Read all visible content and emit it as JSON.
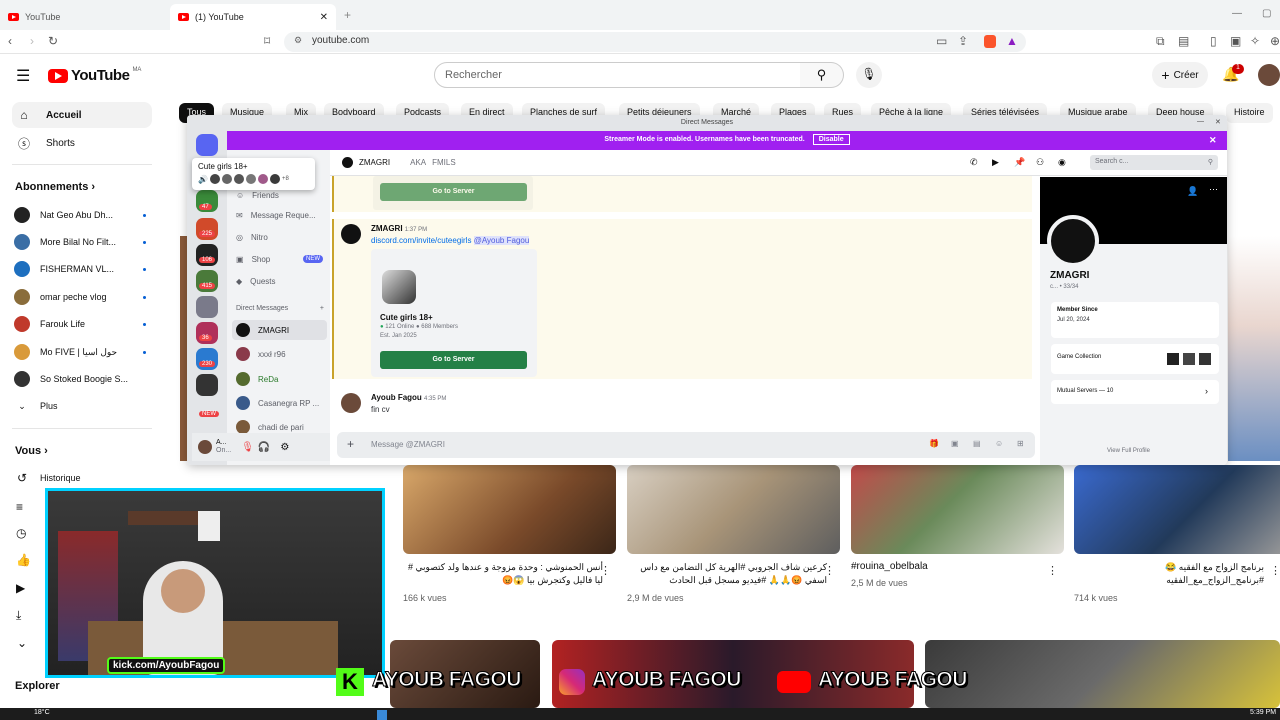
{
  "browser": {
    "tabs": [
      {
        "label": "YouTube"
      },
      {
        "label": "(1) YouTube"
      }
    ],
    "url": "youtube.com"
  },
  "youtube": {
    "logo_text": "YouTube",
    "logo_country": "MA",
    "search_placeholder": "Rechercher",
    "create_label": "Créer",
    "notif_count": "1",
    "sidebar": {
      "items": [
        {
          "label": "Accueil"
        },
        {
          "label": "Shorts"
        }
      ],
      "subscriptions_title": "Abonnements",
      "subscriptions": [
        {
          "label": "Nat Geo Abu Dh...",
          "color": "#222222"
        },
        {
          "label": "More Bilal No Filt...",
          "color": "#3a6ea5"
        },
        {
          "label": "FISHERMAN VL...",
          "color": "#1d6fbf"
        },
        {
          "label": "omar peche vlog",
          "color": "#8a6d3b"
        },
        {
          "label": "Farouk Life",
          "color": "#c0392b"
        },
        {
          "label": "Mo FIVE | حول اسيا",
          "color": "#d99a3a"
        },
        {
          "label": "So Stoked Boogie S...",
          "color": "#333333"
        }
      ],
      "more_label": "Plus",
      "you_title": "Vous",
      "history_label": "Historique",
      "explore_title": "Explorer"
    },
    "chips": [
      "Tous",
      "Musique",
      "Mix",
      "Bodyboard",
      "Podcasts",
      "En direct",
      "Planches de surf",
      "Petits déjeuners",
      "Marché",
      "Plages",
      "Rues",
      "Pêche à la ligne",
      "Séries télévisées",
      "Musique arabe",
      "Deep house",
      "Histoire"
    ],
    "videos": [
      {
        "title": "أنس الحمنوشي : وحدة مزوجة و عندها ولد كتصوبي #\nليا فاليل وكتجرش بيا 😱😡",
        "views": "166 k vues",
        "color": "#b07a3c"
      },
      {
        "title": "كرعين شاف الجروبي #الهرية كل التضامن مع داس\nاسفي 😡🙏🙏 #فيديو مسجل قبل الحادث",
        "views": "2,9 M de vues",
        "color": "#b9a68f"
      },
      {
        "title": "#rouina_obelbala",
        "views": "2,5 M de vues",
        "color": "#7a6d5b"
      },
      {
        "title": "برنامج الزواج مع الفقيه 😂\n#برنامج_الزواج_مع_الفقيه",
        "views": "714 k vues",
        "color": "#4a6a8a"
      }
    ]
  },
  "discord": {
    "window_title": "Direct Messages",
    "streamer_banner": "Streamer Mode is enabled. Usernames have been truncated.",
    "disable_label": "Disable",
    "popup_title": "Cute girls 18+",
    "popup_count": "+8",
    "nav": [
      {
        "label": "Friends"
      },
      {
        "label": "Message Reque..."
      },
      {
        "label": "Nitro"
      },
      {
        "label": "Shop",
        "badge": "NEW"
      },
      {
        "label": "Quests"
      }
    ],
    "dm_header": "Direct Messages",
    "dms": [
      {
        "label": "ZMAGRI",
        "color": "#111111"
      },
      {
        "label": "xxxł r96",
        "color": "#8a3a4a"
      },
      {
        "label": "ReDa",
        "color": "#556b2f"
      },
      {
        "label": "Casanegra RP ...",
        "color": "#3a5a8a"
      },
      {
        "label": "chadi de pari",
        "color": "#7a5a3a"
      }
    ],
    "guild_badges": [
      "47",
      "225",
      "106",
      "415",
      "36",
      "230",
      "NEW"
    ],
    "chat_user": "ZMAGRI",
    "chat_aka": "AKA",
    "chat_aka_value": "FMILS",
    "search_placeholder": "Search c...",
    "go_to_server": "Go to Server",
    "msg1": {
      "author": "ZMAGRI",
      "time": "1:37 PM",
      "link": "discord.com/invite/cuteegirls",
      "mention": "@Ayoub Fagou"
    },
    "invite": {
      "name": "Cute girls 18+",
      "online": "121 Online",
      "members": "688 Members",
      "est": "Est. Jan 2025"
    },
    "msg2": {
      "author": "Ayoub Fagou",
      "time": "4:35 PM",
      "text": "fin cv"
    },
    "composer_placeholder": "Message @ZMAGRI",
    "user_short": "A...",
    "user_status": "On...",
    "profile": {
      "name": "ZMAGRI",
      "sub": "c... • 33/34",
      "member_since_label": "Member Since",
      "member_since": "Jul 20, 2024",
      "game_collection": "Game Collection",
      "mutual_servers": "Mutual Servers — 10",
      "view_full": "View Full Profile"
    }
  },
  "overlay": {
    "kick_handle": "kick.com/AyoubFagou",
    "brand_name": "AYOUB FAGOU"
  },
  "taskbar": {
    "temp": "18°C",
    "clock": "5:39 PM"
  },
  "colors": {
    "yt_red": "#ff0000",
    "discord_purple": "#a020f0",
    "discord_green": "#248046",
    "cam_border": "#00d1ff",
    "kick_green": "#53fc18"
  }
}
